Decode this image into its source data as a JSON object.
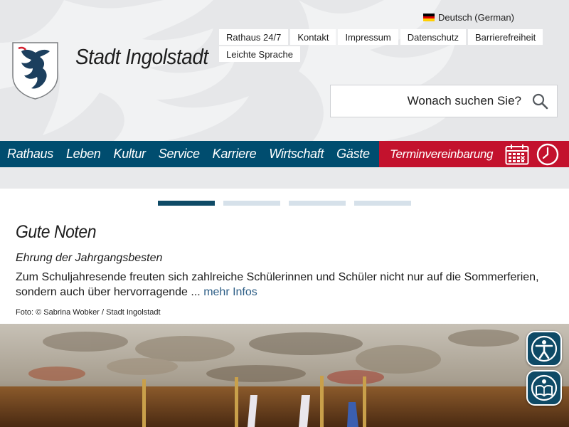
{
  "header": {
    "language": "Deutsch (German)",
    "site_title": "Stadt Ingolstadt",
    "meta_nav": [
      "Rathaus 24/7",
      "Kontakt",
      "Impressum",
      "Datenschutz",
      "Barrierefreiheit",
      "Leichte Sprache"
    ],
    "search": {
      "placeholder": "Wonach suchen Sie?"
    }
  },
  "main_nav": {
    "items": [
      "Rathaus",
      "Leben",
      "Kultur",
      "Service",
      "Karriere",
      "Wirtschaft",
      "Gäste"
    ],
    "cta": "Terminvereinbarung"
  },
  "slider": {
    "count": 4,
    "active_index": 0
  },
  "article": {
    "title": "Gute Noten",
    "subtitle": "Ehrung der Jahrgangsbesten",
    "text": "Zum Schuljahresende freuten sich zahlreiche Schülerinnen und Schüler nicht nur auf die Sommerferien, sondern auch über hervorragende ...",
    "more_link": "mehr Infos",
    "credit": "Foto: © Sabrina Wobker / Stadt Ingolstadt"
  },
  "colors": {
    "nav_blue": "#004d6f",
    "cta_red": "#c3122d",
    "link_blue": "#2d5e86",
    "header_gray": "#e6e7e9"
  },
  "icons": [
    "flag-de-icon",
    "search-icon",
    "calendar-icon",
    "clock-icon",
    "accessibility-icon",
    "easy-read-icon",
    "coat-of-arms-logo"
  ]
}
